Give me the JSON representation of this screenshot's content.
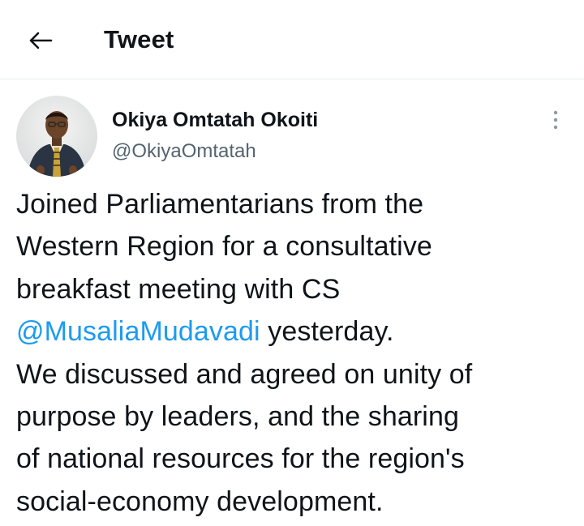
{
  "header": {
    "back_icon": "arrow-left-icon",
    "title": "Tweet"
  },
  "author": {
    "avatar_icon": "profile-photo",
    "name": "Okiya Omtatah Okoiti",
    "handle": "@OkiyaOmtatah",
    "more_icon": "more-vertical-icon"
  },
  "tweet": {
    "line1": "Joined Parliamentarians from the",
    "line2": "Western Region for a consultative",
    "line3": "breakfast meeting with CS",
    "mention": "@MusaliaMudavadi",
    "line4_rest": " yesterday.",
    "line5": "We discussed and agreed on unity of",
    "line6": "purpose by leaders, and the sharing",
    "line7": "of national resources for the region's",
    "line8": "social-economy development."
  },
  "colors": {
    "text": "#0f1419",
    "secondary": "#536471",
    "link": "#1d9bf0",
    "divider": "#e6ecf0"
  }
}
